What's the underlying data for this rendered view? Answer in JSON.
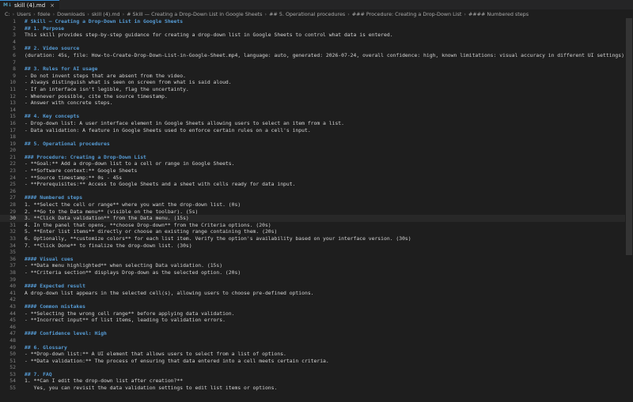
{
  "tab": {
    "icon": "markdown-icon",
    "label": "skill (4).md",
    "close": "×"
  },
  "breadcrumb": [
    "C:",
    "Users",
    "fdele",
    "Downloads",
    "skill (4).md",
    "# Skill — Creating a Drop-Down List in Google Sheets",
    "## 5. Operational procedures",
    "### Procedure: Creating a Drop-Down List",
    "#### Numbered steps"
  ],
  "editor": {
    "current_line": 30,
    "lines": [
      {
        "n": "1",
        "t": "# Skill — Creating a Drop-Down List in Google Sheets",
        "k": "h1"
      },
      {
        "n": "2",
        "t": "## 1. Purpose",
        "k": "h2"
      },
      {
        "n": "3",
        "t": "This skill provides step-by-step guidance for creating a drop-down list in Google Sheets to control what data is entered.",
        "k": ""
      },
      {
        "n": "4",
        "t": "",
        "k": ""
      },
      {
        "n": "5",
        "t": "## 2. Video source",
        "k": "h2"
      },
      {
        "n": "6",
        "t": "(duration: 45s, file: How-to-Create-Drop-Down-List-in-Google-Sheet.mp4, language: auto, generated: 2026-07-24, overall confidence: high, known limitations: visual accuracy in different UI settings)",
        "k": ""
      },
      {
        "n": "7",
        "t": "",
        "k": ""
      },
      {
        "n": "8",
        "t": "## 3. Rules for AI usage",
        "k": "h2"
      },
      {
        "n": "9",
        "t": "- Do not invent steps that are absent from the video.",
        "k": ""
      },
      {
        "n": "10",
        "t": "- Always distinguish what is seen on screen from what is said aloud.",
        "k": ""
      },
      {
        "n": "11",
        "t": "- If an interface isn't legible, flag the uncertainty.",
        "k": ""
      },
      {
        "n": "12",
        "t": "- Whenever possible, cite the source timestamp.",
        "k": ""
      },
      {
        "n": "13",
        "t": "- Answer with concrete steps.",
        "k": ""
      },
      {
        "n": "14",
        "t": "",
        "k": ""
      },
      {
        "n": "15",
        "t": "## 4. Key concepts",
        "k": "h2"
      },
      {
        "n": "16",
        "t": "- Drop-down list: A user interface element in Google Sheets allowing users to select an item from a list.",
        "k": ""
      },
      {
        "n": "17",
        "t": "- Data validation: A feature in Google Sheets used to enforce certain rules on a cell's input.",
        "k": ""
      },
      {
        "n": "18",
        "t": "",
        "k": ""
      },
      {
        "n": "19",
        "t": "## 5. Operational procedures",
        "k": "h2"
      },
      {
        "n": "20",
        "t": "",
        "k": ""
      },
      {
        "n": "21",
        "t": "### Procedure: Creating a Drop-Down List",
        "k": "h3"
      },
      {
        "n": "22",
        "t": "- **Goal:** Add a drop-down list to a cell or range in Google Sheets.",
        "k": ""
      },
      {
        "n": "23",
        "t": "- **Software context:** Google Sheets",
        "k": ""
      },
      {
        "n": "24",
        "t": "- **Source timestamp:** 0s - 45s",
        "k": ""
      },
      {
        "n": "25",
        "t": "- **Prerequisites:** Access to Google Sheets and a sheet with cells ready for data input.",
        "k": ""
      },
      {
        "n": "26",
        "t": "",
        "k": ""
      },
      {
        "n": "27",
        "t": "#### Numbered steps",
        "k": "h4"
      },
      {
        "n": "28",
        "t": "1. **Select the cell or range** where you want the drop-down list. (0s)",
        "k": ""
      },
      {
        "n": "29",
        "t": "2. **Go to the Data menu** (visible on the toolbar). (5s)",
        "k": ""
      },
      {
        "n": "30",
        "t": "3. **Click Data validation** from the Data menu. (15s)",
        "k": ""
      },
      {
        "n": "31",
        "t": "4. In the panel that opens, **choose Drop-down** from the Criteria options. (20s)",
        "k": ""
      },
      {
        "n": "32",
        "t": "5. **Enter list items** directly or choose an existing range containing them. (20s)",
        "k": ""
      },
      {
        "n": "33",
        "t": "6. Optionally, **customize colors** for each list item. Verify the option's availability based on your interface version. (30s)",
        "k": ""
      },
      {
        "n": "34",
        "t": "7. **Click Done** to finalize the drop-down list. (30s)",
        "k": ""
      },
      {
        "n": "35",
        "t": "",
        "k": ""
      },
      {
        "n": "36",
        "t": "#### Visual cues",
        "k": "h4"
      },
      {
        "n": "37",
        "t": "- **Data menu highlighted** when selecting Data validation. (15s)",
        "k": ""
      },
      {
        "n": "38",
        "t": "- **Criteria section** displays Drop-down as the selected option. (20s)",
        "k": ""
      },
      {
        "n": "39",
        "t": "",
        "k": ""
      },
      {
        "n": "40",
        "t": "#### Expected result",
        "k": "h4"
      },
      {
        "n": "41",
        "t": "A drop-down list appears in the selected cell(s), allowing users to choose pre-defined options.",
        "k": ""
      },
      {
        "n": "42",
        "t": "",
        "k": ""
      },
      {
        "n": "43",
        "t": "#### Common mistakes",
        "k": "h4"
      },
      {
        "n": "44",
        "t": "- **Selecting the wrong cell range** before applying data validation.",
        "k": ""
      },
      {
        "n": "45",
        "t": "- **Incorrect input** of list items, leading to validation errors.",
        "k": ""
      },
      {
        "n": "46",
        "t": "",
        "k": ""
      },
      {
        "n": "47",
        "t": "#### Confidence level: High",
        "k": "h4"
      },
      {
        "n": "48",
        "t": "",
        "k": ""
      },
      {
        "n": "49",
        "t": "## 6. Glossary",
        "k": "h2"
      },
      {
        "n": "50",
        "t": "- **Drop-down list:** A UI element that allows users to select from a list of options.",
        "k": ""
      },
      {
        "n": "51",
        "t": "- **Data validation:** The process of ensuring that data entered into a cell meets certain criteria.",
        "k": ""
      },
      {
        "n": "52",
        "t": "",
        "k": ""
      },
      {
        "n": "53",
        "t": "## 7. FAQ",
        "k": "h2"
      },
      {
        "n": "54",
        "t": "1. **Can I edit the drop-down list after creation?**",
        "k": ""
      },
      {
        "n": "55",
        "t": "   Yes, you can revisit the data validation settings to edit list items or options.",
        "k": ""
      }
    ]
  }
}
